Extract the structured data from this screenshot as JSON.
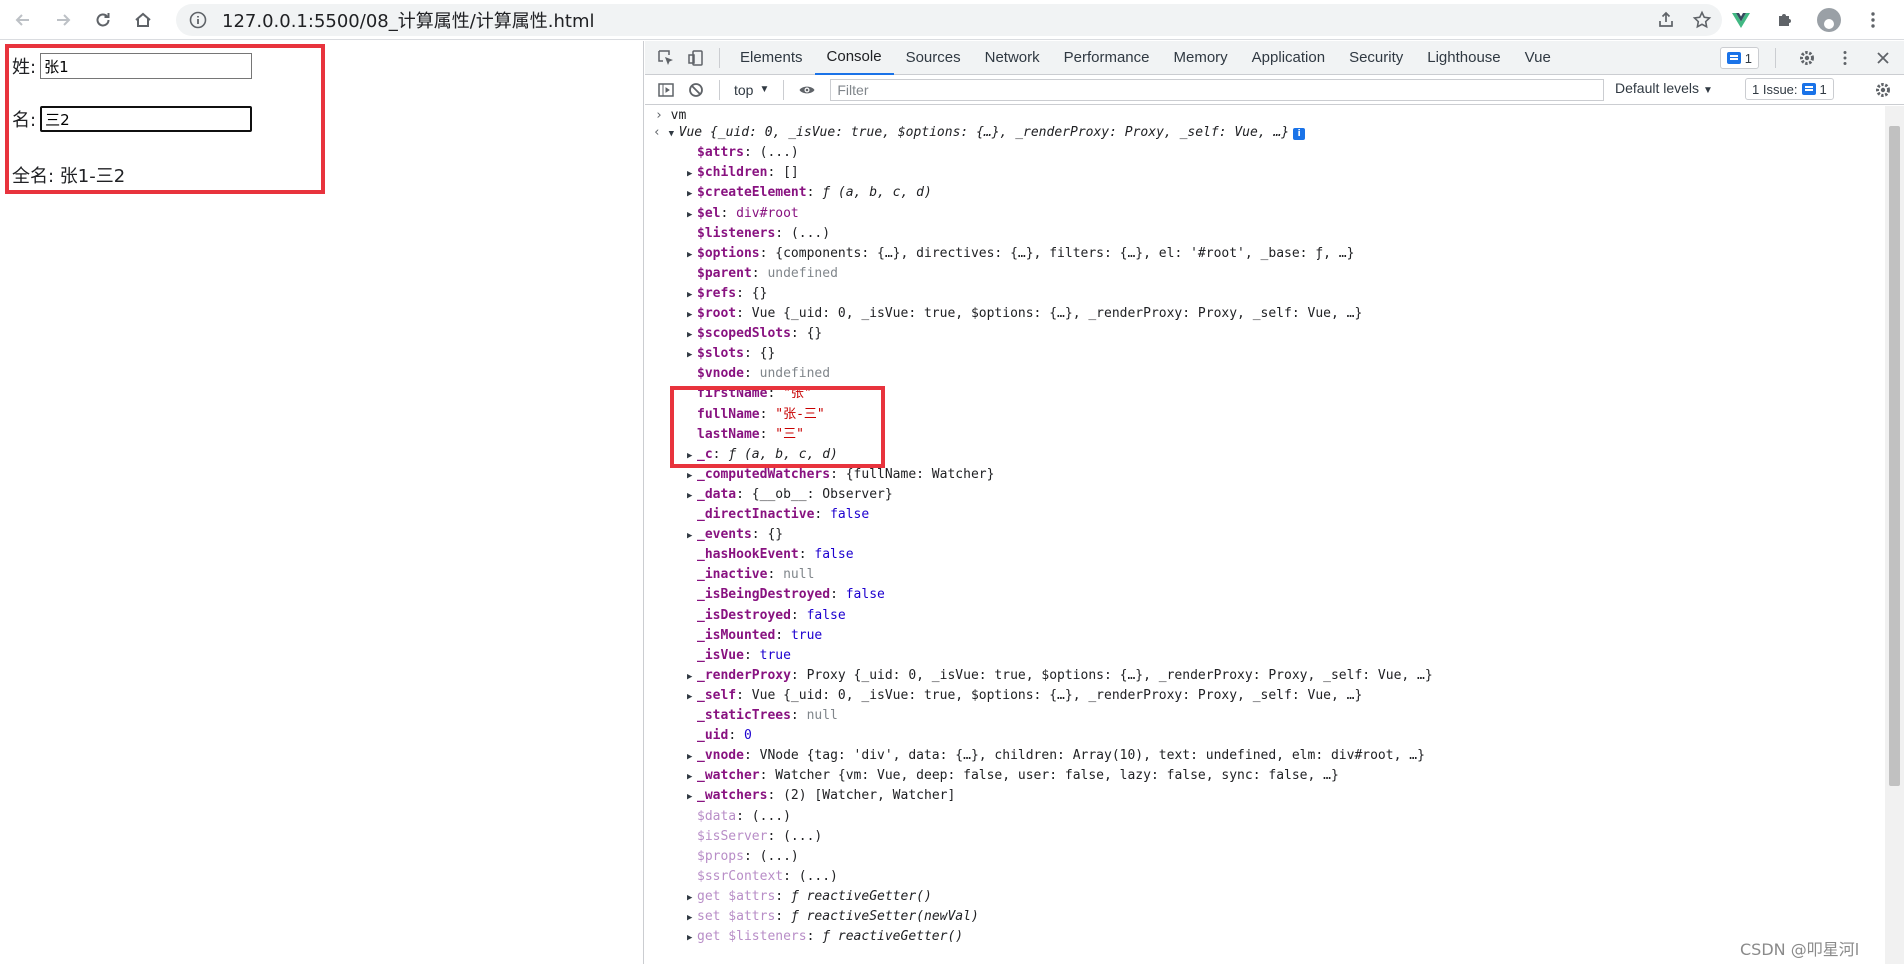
{
  "browser": {
    "url": "127.0.0.1:5500/08_计算属性/计算属性.html"
  },
  "page": {
    "last_label": "姓:",
    "last_value": "张1",
    "first_label": "名:",
    "first_value": "三2",
    "full_label": "全名: 张1-三2"
  },
  "devtools": {
    "tabs": [
      "Elements",
      "Console",
      "Sources",
      "Network",
      "Performance",
      "Memory",
      "Application",
      "Security",
      "Lighthouse",
      "Vue"
    ],
    "active_tab": "Console",
    "message_count": "1",
    "context": "top",
    "filter_placeholder": "Filter",
    "levels": "Default levels",
    "issues": "1 Issue:",
    "issues_count": "1"
  },
  "console": {
    "input": "vm",
    "lines": [
      {
        "t": "▼",
        "html": "Vue {_uid: 0, _isVue: true, $options: {…}, _renderProxy: Proxy, _self: Vue, …}"
      },
      {
        "key": "$attrs",
        "val": "(...)"
      },
      {
        "key": "$children",
        "val": "[]",
        "tri": true
      },
      {
        "key": "$createElement",
        "val": "ƒ (a, b, c, d)",
        "tri": true
      },
      {
        "key": "$el",
        "val": "div#root",
        "tri": true
      },
      {
        "key": "$listeners",
        "val": "(...)"
      },
      {
        "key": "$options",
        "val": "{components: {…}, directives: {…}, filters: {…}, el: '#root', _base: ƒ, …}",
        "tri": true
      },
      {
        "key": "$parent",
        "val": "undefined"
      },
      {
        "key": "$refs",
        "val": "{}",
        "tri": true
      },
      {
        "key": "$root",
        "val": "Vue {_uid: 0, _isVue: true, $options: {…}, _renderProxy: Proxy, _self: Vue, …}",
        "tri": true
      },
      {
        "key": "$scopedSlots",
        "val": "{}",
        "tri": true
      },
      {
        "key": "$slots",
        "val": "{}",
        "tri": true
      },
      {
        "key": "$vnode",
        "val": "undefined"
      },
      {
        "key": "firstName",
        "val": "\"张\""
      },
      {
        "key": "fullName",
        "val": "\"张-三\""
      },
      {
        "key": "lastName",
        "val": "\"三\""
      },
      {
        "key": "_c",
        "val": "ƒ (a, b, c, d)",
        "tri": true
      },
      {
        "key": "_computedWatchers",
        "val": "{fullName: Watcher}",
        "tri": true
      },
      {
        "key": "_data",
        "val": "{__ob__: Observer}",
        "tri": true
      },
      {
        "key": "_directInactive",
        "val": "false"
      },
      {
        "key": "_events",
        "val": "{}",
        "tri": true
      },
      {
        "key": "_hasHookEvent",
        "val": "false"
      },
      {
        "key": "_inactive",
        "val": "null"
      },
      {
        "key": "_isBeingDestroyed",
        "val": "false"
      },
      {
        "key": "_isDestroyed",
        "val": "false"
      },
      {
        "key": "_isMounted",
        "val": "true"
      },
      {
        "key": "_isVue",
        "val": "true"
      },
      {
        "key": "_renderProxy",
        "val": "Proxy {_uid: 0, _isVue: true, $options: {…}, _renderProxy: Proxy, _self: Vue, …}",
        "tri": true
      },
      {
        "key": "_self",
        "val": "Vue {_uid: 0, _isVue: true, $options: {…}, _renderProxy: Proxy, _self: Vue, …}",
        "tri": true
      },
      {
        "key": "_staticTrees",
        "val": "null"
      },
      {
        "key": "_uid",
        "val": "0"
      },
      {
        "key": "_vnode",
        "val": "VNode {tag: 'div', data: {…}, children: Array(10), text: undefined, elm: div#root, …}",
        "tri": true
      },
      {
        "key": "_watcher",
        "val": "Watcher {vm: Vue, deep: false, user: false, lazy: false, sync: false, …}",
        "tri": true
      },
      {
        "key": "_watchers",
        "val": "(2) [Watcher, Watcher]",
        "tri": true
      },
      {
        "key": "$data",
        "val": "(...)",
        "dim": true
      },
      {
        "key": "$isServer",
        "val": "(...)",
        "dim": true
      },
      {
        "key": "$props",
        "val": "(...)",
        "dim": true
      },
      {
        "key": "$ssrContext",
        "val": "(...)",
        "dim": true
      },
      {
        "key": "get $attrs",
        "val": "ƒ reactiveGetter()",
        "tri": true,
        "dim": true
      },
      {
        "key": "set $attrs",
        "val": "ƒ reactiveSetter(newVal)",
        "tri": true,
        "dim": true
      },
      {
        "key": "get $listeners",
        "val": "ƒ reactiveGetter()",
        "tri": true,
        "dim": true
      }
    ]
  },
  "watermark": "CSDN @叩星河l"
}
